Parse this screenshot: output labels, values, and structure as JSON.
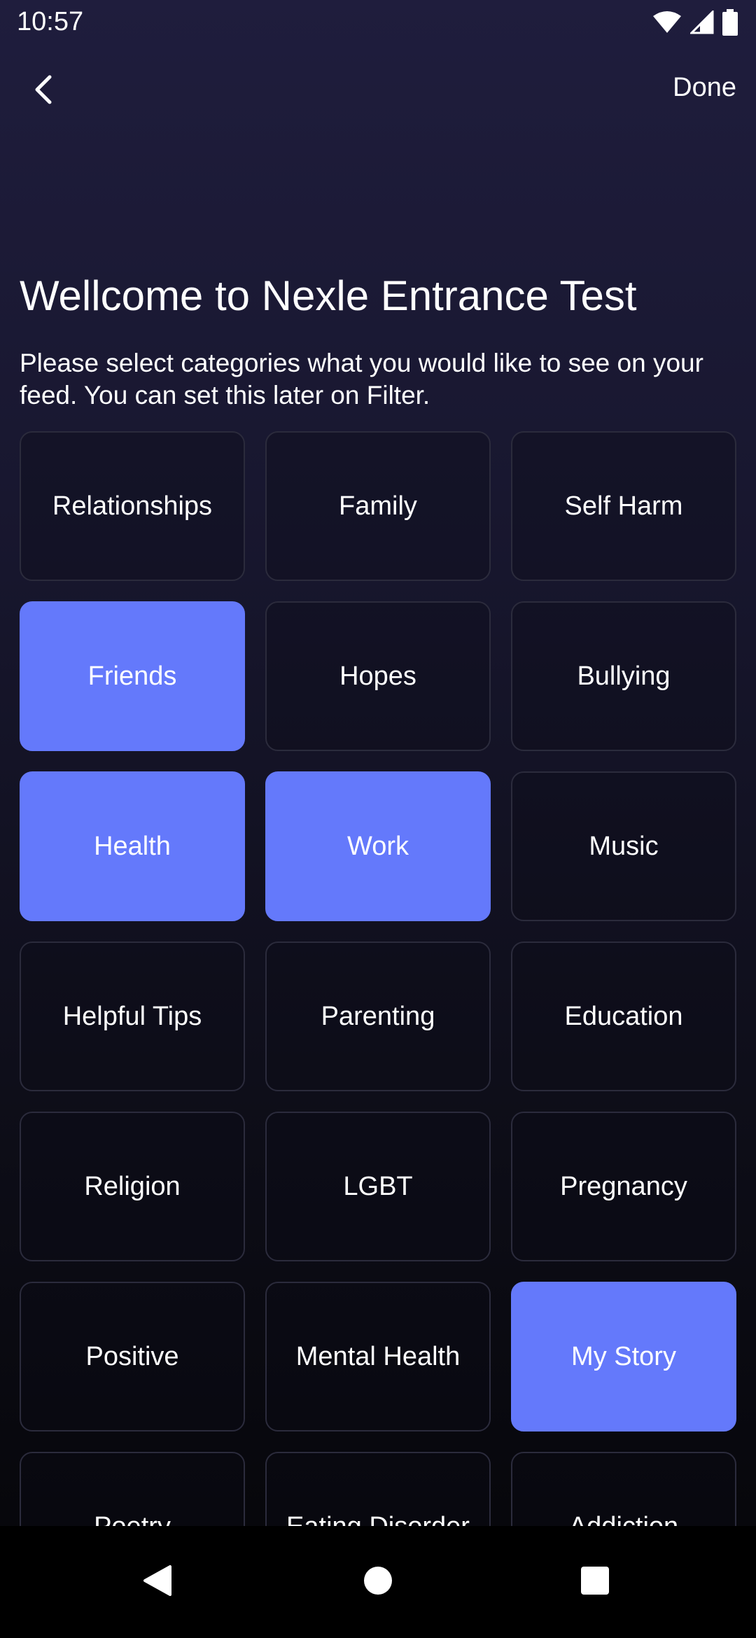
{
  "status_bar": {
    "time": "10:57",
    "icons": [
      "wifi-icon",
      "signal-icon",
      "battery-icon"
    ]
  },
  "top_bar": {
    "back_icon": "chevron-left-icon",
    "done_label": "Done"
  },
  "header": {
    "title": "Wellcome to Nexle Entrance Test",
    "subtitle": "Please select categories what you would like to see on your feed. You can set this later on Filter."
  },
  "categories": [
    {
      "label": "Relationships",
      "selected": false
    },
    {
      "label": "Family",
      "selected": false
    },
    {
      "label": "Self Harm",
      "selected": false
    },
    {
      "label": "Friends",
      "selected": true
    },
    {
      "label": "Hopes",
      "selected": false
    },
    {
      "label": "Bullying",
      "selected": false
    },
    {
      "label": "Health",
      "selected": true
    },
    {
      "label": "Work",
      "selected": true
    },
    {
      "label": "Music",
      "selected": false
    },
    {
      "label": "Helpful Tips",
      "selected": false
    },
    {
      "label": "Parenting",
      "selected": false
    },
    {
      "label": "Education",
      "selected": false
    },
    {
      "label": "Religion",
      "selected": false
    },
    {
      "label": "LGBT",
      "selected": false
    },
    {
      "label": "Pregnancy",
      "selected": false
    },
    {
      "label": "Positive",
      "selected": false
    },
    {
      "label": "Mental Health",
      "selected": false
    },
    {
      "label": "My Story",
      "selected": true
    },
    {
      "label": "Poetry",
      "selected": false
    },
    {
      "label": "Eating Disorder",
      "selected": false
    },
    {
      "label": "Addiction",
      "selected": false
    }
  ],
  "colors": {
    "accent": "#6479fb",
    "tile_border": "#2b2b3c",
    "background_top": "#1f1d3d",
    "background_bottom": "#050508"
  },
  "nav_bar": {
    "icons": [
      "back-triangle-icon",
      "home-circle-icon",
      "recents-square-icon"
    ]
  }
}
